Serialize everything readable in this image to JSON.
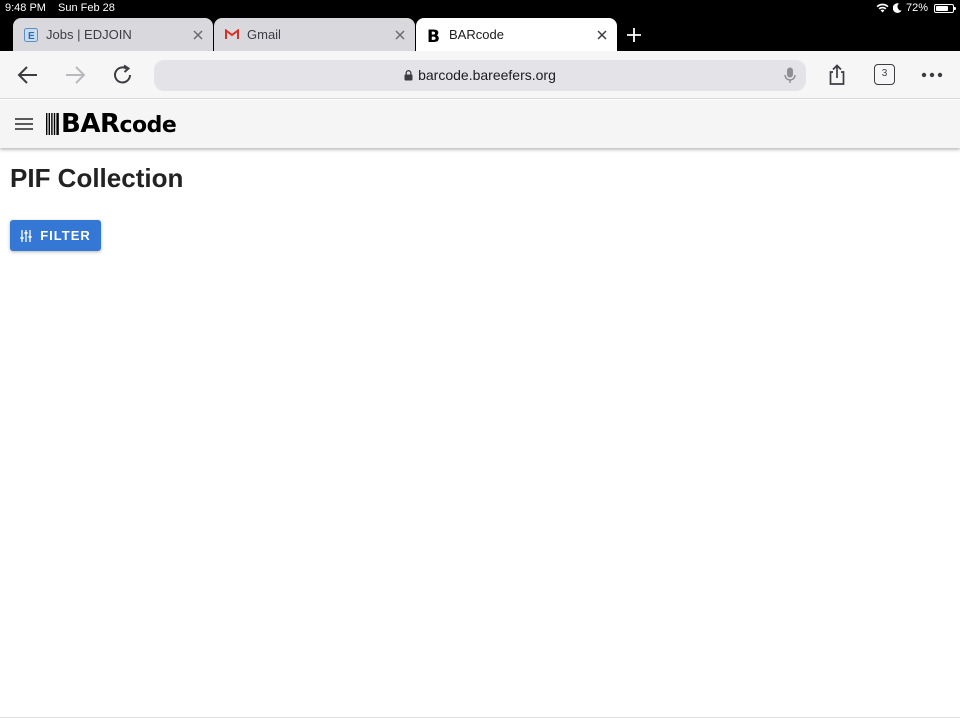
{
  "status_bar": {
    "time": "9:48 PM",
    "date": "Sun Feb 28",
    "battery": "72%",
    "battery_level": 0.72,
    "icons": [
      "wifi-icon",
      "moon-icon",
      "battery-icon"
    ]
  },
  "tabs": [
    {
      "title": "Jobs | EDJOIN",
      "favicon": "edjoin-favicon",
      "active": false
    },
    {
      "title": "Gmail",
      "favicon": "gmail-favicon",
      "active": false
    },
    {
      "title": "BARcode",
      "favicon": "barcode-favicon",
      "active": true
    }
  ],
  "toolbar": {
    "url": "barcode.bareefers.org",
    "tab_count": "3",
    "icons": [
      "back-icon",
      "forward-icon",
      "reload-icon",
      "lock-icon",
      "mic-icon",
      "share-icon",
      "tabs-icon",
      "more-icon"
    ]
  },
  "app_bar": {
    "logo_caps": "BAR",
    "logo_rest": "code"
  },
  "page": {
    "title": "PIF Collection",
    "filter_label": "FILTER"
  },
  "colors": {
    "accent": "#3477d5",
    "gmail_red": "#d93025"
  }
}
